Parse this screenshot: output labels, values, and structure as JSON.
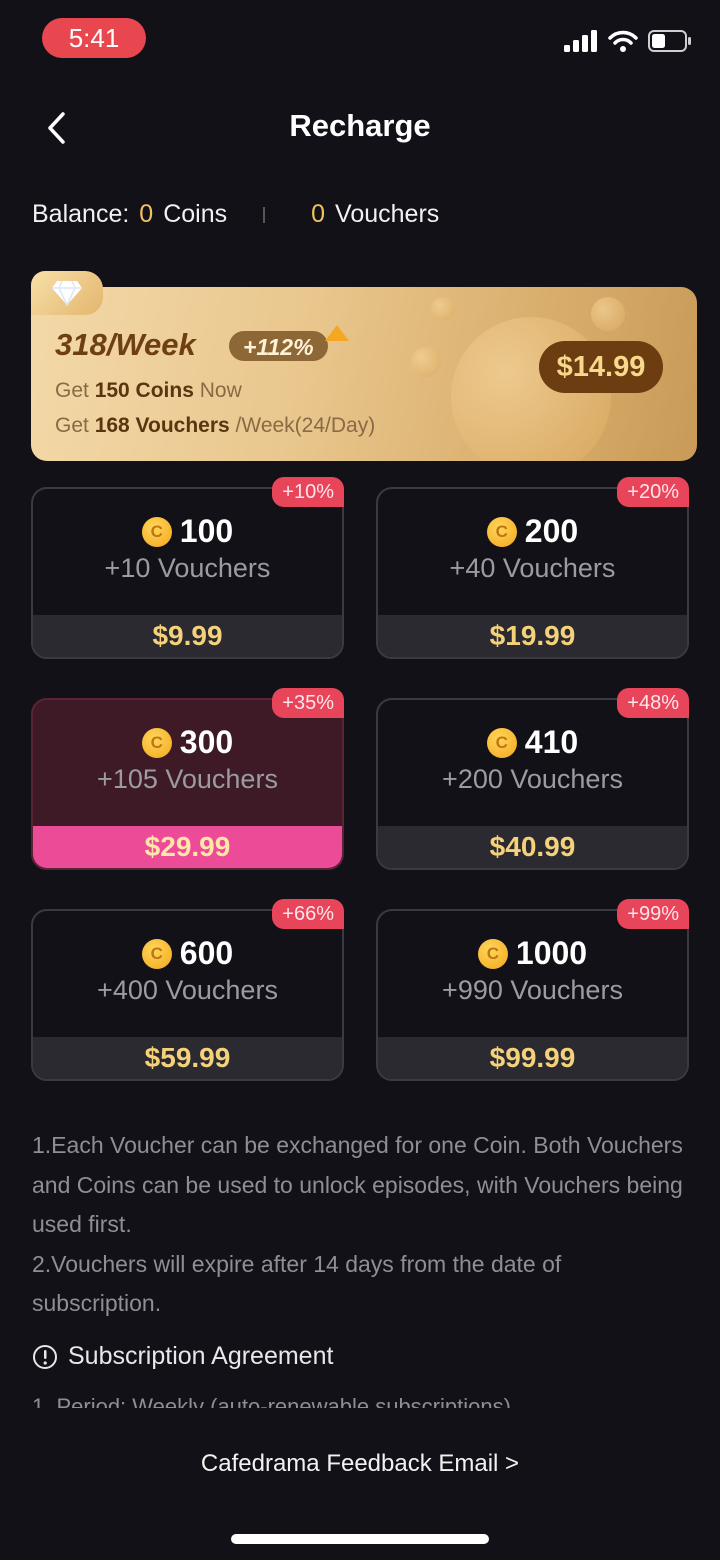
{
  "status_bar": {
    "time": "5:41"
  },
  "header": {
    "title": "Recharge"
  },
  "balance": {
    "label": "Balance:",
    "coins_value": "0",
    "coins_label": "Coins",
    "vouchers_value": "0",
    "vouchers_label": "Vouchers"
  },
  "weekly": {
    "title": "318/Week",
    "tag": "+112%",
    "line1_prefix": "Get ",
    "line1_bold": "150 Coins",
    "line1_suffix": " Now",
    "line2_prefix": "Get ",
    "line2_bold": "168 Vouchers",
    "line2_suffix": " /Week(24/Day)",
    "price": "$14.99"
  },
  "packages": [
    {
      "coins": "100",
      "vouchers": "+10 Vouchers",
      "price": "$9.99",
      "badge": "+10%",
      "selected": false
    },
    {
      "coins": "200",
      "vouchers": "+40 Vouchers",
      "price": "$19.99",
      "badge": "+20%",
      "selected": false
    },
    {
      "coins": "300",
      "vouchers": "+105 Vouchers",
      "price": "$29.99",
      "badge": "+35%",
      "selected": true
    },
    {
      "coins": "410",
      "vouchers": "+200 Vouchers",
      "price": "$40.99",
      "badge": "+48%",
      "selected": false
    },
    {
      "coins": "600",
      "vouchers": "+400 Vouchers",
      "price": "$59.99",
      "badge": "+66%",
      "selected": false
    },
    {
      "coins": "1000",
      "vouchers": "+990 Vouchers",
      "price": "$99.99",
      "badge": "+99%",
      "selected": false
    }
  ],
  "coin_symbol": "C",
  "notes": {
    "line1": "1.Each Voucher can be exchanged for one Coin. Both Vouchers and Coins can be used to unlock episodes, with Vouchers being used first.",
    "line2": "2.Vouchers will expire after 14 days from the date of subscription."
  },
  "agreement": {
    "title": "Subscription Agreement",
    "preview": "1. Period: Weekly (auto-renewable subscriptions)"
  },
  "feedback": {
    "label": "Cafedrama Feedback Email >"
  },
  "colors": {
    "accent_gold": "#f5d17a",
    "selected_pink": "#ec4b98",
    "badge_red": "#e8455b"
  }
}
